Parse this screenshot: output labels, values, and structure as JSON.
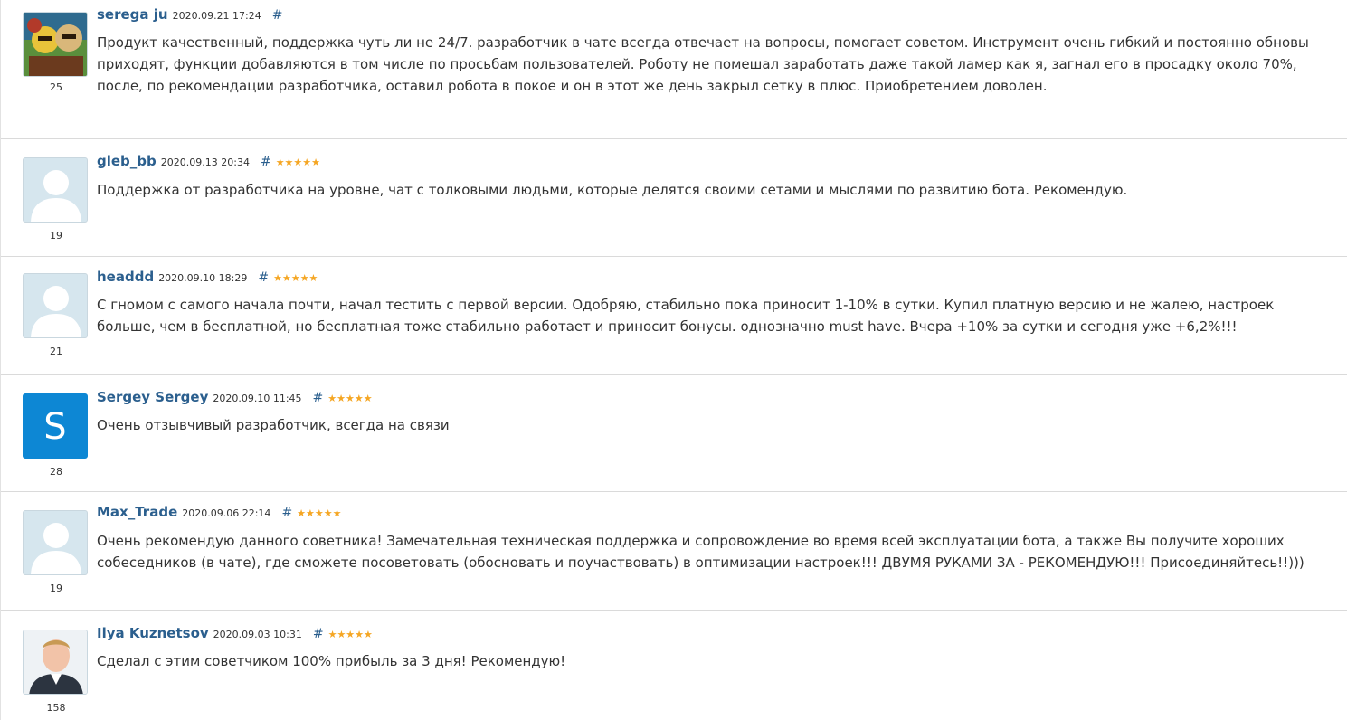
{
  "reviews": [
    {
      "author": "serega ju",
      "date": "2020.09.21 17:24",
      "hash": "#",
      "rating": 0,
      "score": "25",
      "avatar": "photo-cartoon",
      "text": "Продукт качественный, поддержка чуть ли не 24/7. разработчик в чате всегда отвечает на вопросы, помогает советом. Инструмент очень гибкий и постоянно обновы приходят, функции добавляются в том числе по просьбам пользователей. Роботу не помешал заработать даже такой ламер как я, загнал его в просадку около 70%, после, по рекомендации разработчика, оставил робота в покое и он в этот же день закрыл сетку в плюс. Приобретением доволен."
    },
    {
      "author": "gleb_bb",
      "date": "2020.09.13 20:34",
      "hash": "#",
      "rating": 5,
      "stars": "★★★★★",
      "score": "19",
      "avatar": "default-user",
      "text": "Поддержка от разработчика на уровне, чат с толковыми людьми, которые делятся своими сетами и мыслями по развитию бота. Рекомендую."
    },
    {
      "author": "headdd",
      "date": "2020.09.10 18:29",
      "hash": "#",
      "rating": 5,
      "stars": "★★★★★",
      "score": "21",
      "avatar": "default-user",
      "text": "С гномом с самого начала почти, начал тестить с первой версии. Одобряю, стабильно пока приносит 1-10% в сутки. Купил платную версию и не жалею, настроек больше, чем в бесплатной, но бесплатная тоже стабильно работает и приносит бонусы. однозначно must have. Вчера +10% за сутки и сегодня уже +6,2%!!!"
    },
    {
      "author": "Sergey Sergey",
      "date": "2020.09.10 11:45",
      "hash": "#",
      "rating": 5,
      "stars": "★★★★★",
      "score": "28",
      "avatar": "letter",
      "avatar_letter": "S",
      "text": "Очень отзывчивый разработчик, всегда на связи"
    },
    {
      "author": "Max_Trade",
      "date": "2020.09.06 22:14",
      "hash": "#",
      "rating": 5,
      "stars": "★★★★★",
      "score": "19",
      "avatar": "default-user",
      "text": "Очень рекомендую данного советника! Замечательная техническая поддержка и сопровождение во время всей эксплуатации бота, а также Вы получите хороших собеседников (в чате), где сможете посоветовать (обосновать и поучаствовать) в оптимизации настроек!!! ДВУМЯ РУКАМИ ЗА - РЕКОМЕНДУЮ!!! Присоединяйтесь!!)))"
    },
    {
      "author": "Ilya Kuznetsov",
      "date": "2020.09.03 10:31",
      "hash": "#",
      "rating": 5,
      "stars": "★★★★★",
      "score": "158",
      "avatar": "photo-person",
      "text": "Сделал с этим советчиком 100% прибыль за 3 дня! Рекомендую!"
    }
  ],
  "colors": {
    "author_link": "#2b5f8e",
    "star": "#f5a623",
    "letter_avatar": "#0d87d4",
    "default_avatar_bg": "#d6e6ee"
  }
}
